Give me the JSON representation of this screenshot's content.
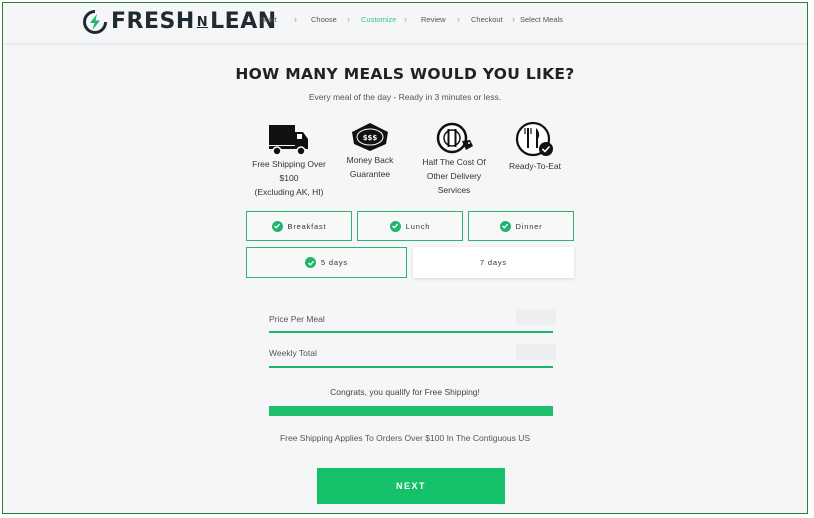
{
  "brand": {
    "logo_left": "FRESH",
    "logo_mid": "N",
    "logo_right": "LEAN",
    "accent": "#21b46b"
  },
  "steps": [
    "Start",
    "Choose",
    "Customize",
    "Review",
    "Checkout",
    "Select Meals"
  ],
  "active_step": "Customize",
  "title": "HOW MANY MEALS WOULD YOU LIKE?",
  "subtitle": "Every meal of the day - Ready in 3 minutes or less.",
  "features": [
    {
      "icon": "delivery-truck-icon",
      "line1": "Free Shipping Over",
      "line2": "$100",
      "line3": "(Excluding AK, HI)"
    },
    {
      "icon": "money-back-badge-icon",
      "badge": "$$$",
      "line1": "Money Back",
      "line2": "Guarantee"
    },
    {
      "icon": "plate-price-tag-icon",
      "line1": "Half The Cost Of",
      "line2": "Other Delivery",
      "line3": "Services"
    },
    {
      "icon": "plate-cutlery-check-icon",
      "line1": "Ready-To-Eat"
    }
  ],
  "meals": [
    {
      "label": "Breakfast",
      "selected": true
    },
    {
      "label": "Lunch",
      "selected": true
    },
    {
      "label": "Dinner",
      "selected": true
    }
  ],
  "days": [
    {
      "label": "5 days",
      "selected": true
    },
    {
      "label": "7 days",
      "selected": false
    }
  ],
  "pricing": {
    "price_per_meal_label": "Price Per Meal",
    "weekly_total_label": "Weekly Total"
  },
  "congrats": "Congrats, you qualify for Free Shipping!",
  "free_shipping_progress": 1.0,
  "ship_note": "Free Shipping Applies To Orders Over $100 In The Contiguous US",
  "next_label": "NEXT"
}
